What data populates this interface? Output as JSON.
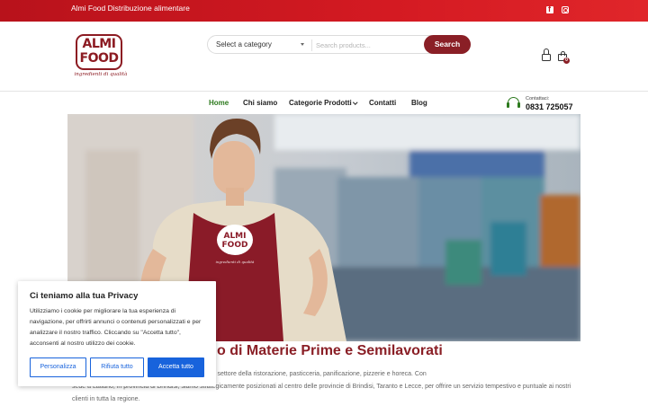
{
  "topbar": {
    "tagline": "Almi Food Distribuzione alimentare",
    "social": [
      "facebook-icon",
      "instagram-icon"
    ],
    "colors": {
      "bar": "#d41a22"
    }
  },
  "logo": {
    "line1": "ALMI",
    "line2": "FOOD",
    "tagline": "ingredienti di qualità",
    "color": "#8c1b22"
  },
  "search": {
    "category_value": "Select a category",
    "placeholder": "Search products...",
    "button_label": "Search",
    "button_color": "#8a1f26"
  },
  "cart": {
    "count": "0"
  },
  "nav": {
    "items": [
      {
        "label": "Home",
        "active": true
      },
      {
        "label": "Chi siamo"
      },
      {
        "label": "Categorie Prodotti",
        "has_dropdown": true
      },
      {
        "label": "Contatti"
      },
      {
        "label": "Blog"
      }
    ],
    "active_color": "#2d7a1e"
  },
  "contact": {
    "label": "Contattaci:",
    "phone": "0831 725057"
  },
  "hero": {
    "apron_logo_line1": "ALMI",
    "apron_logo_line2": "FOOD",
    "apron_logo_tagline": "ingredienti di qualità"
  },
  "main": {
    "heading": "o di Materie Prime e Semilavorati",
    "paragraph_line1": "a distribuzione di materie prime e semilavorati per il settore della ristorazione, pasticceria, panificazione, pizzerie e horeca. Con",
    "paragraph_line2": "sede a Latiano, in provincia di Brindisi, siamo strategicamente posizionati al centro delle provincie di Brindisi, Taranto e Lecce, per offrire un servizio tempestivo e puntuale ai nostri",
    "paragraph_line3": "clienti in tutta la regione."
  },
  "cookie_banner": {
    "title": "Ci teniamo alla tua Privacy",
    "message": "Utilizziamo i cookie per migliorare la tua esperienza di navigazione, per offrirti annunci o contenuti personalizzati e per analizzare il nostro traffico. Cliccando su \"Accetta tutto\", acconsenti al nostro utilizzo dei cookie.",
    "customize_label": "Personalizza",
    "reject_label": "Rifiuta tutto",
    "accept_label": "Accetta tutto",
    "accent_color": "#1863dc"
  }
}
